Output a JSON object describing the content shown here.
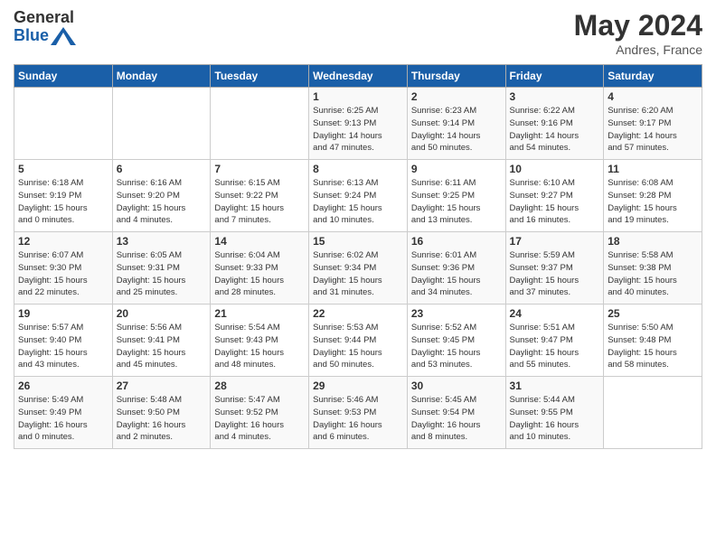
{
  "header": {
    "logo_general": "General",
    "logo_blue": "Blue",
    "month_year": "May 2024",
    "location": "Andres, France"
  },
  "days_of_week": [
    "Sunday",
    "Monday",
    "Tuesday",
    "Wednesday",
    "Thursday",
    "Friday",
    "Saturday"
  ],
  "weeks": [
    [
      {
        "day": "",
        "detail": ""
      },
      {
        "day": "",
        "detail": ""
      },
      {
        "day": "",
        "detail": ""
      },
      {
        "day": "1",
        "detail": "Sunrise: 6:25 AM\nSunset: 9:13 PM\nDaylight: 14 hours\nand 47 minutes."
      },
      {
        "day": "2",
        "detail": "Sunrise: 6:23 AM\nSunset: 9:14 PM\nDaylight: 14 hours\nand 50 minutes."
      },
      {
        "day": "3",
        "detail": "Sunrise: 6:22 AM\nSunset: 9:16 PM\nDaylight: 14 hours\nand 54 minutes."
      },
      {
        "day": "4",
        "detail": "Sunrise: 6:20 AM\nSunset: 9:17 PM\nDaylight: 14 hours\nand 57 minutes."
      }
    ],
    [
      {
        "day": "5",
        "detail": "Sunrise: 6:18 AM\nSunset: 9:19 PM\nDaylight: 15 hours\nand 0 minutes."
      },
      {
        "day": "6",
        "detail": "Sunrise: 6:16 AM\nSunset: 9:20 PM\nDaylight: 15 hours\nand 4 minutes."
      },
      {
        "day": "7",
        "detail": "Sunrise: 6:15 AM\nSunset: 9:22 PM\nDaylight: 15 hours\nand 7 minutes."
      },
      {
        "day": "8",
        "detail": "Sunrise: 6:13 AM\nSunset: 9:24 PM\nDaylight: 15 hours\nand 10 minutes."
      },
      {
        "day": "9",
        "detail": "Sunrise: 6:11 AM\nSunset: 9:25 PM\nDaylight: 15 hours\nand 13 minutes."
      },
      {
        "day": "10",
        "detail": "Sunrise: 6:10 AM\nSunset: 9:27 PM\nDaylight: 15 hours\nand 16 minutes."
      },
      {
        "day": "11",
        "detail": "Sunrise: 6:08 AM\nSunset: 9:28 PM\nDaylight: 15 hours\nand 19 minutes."
      }
    ],
    [
      {
        "day": "12",
        "detail": "Sunrise: 6:07 AM\nSunset: 9:30 PM\nDaylight: 15 hours\nand 22 minutes."
      },
      {
        "day": "13",
        "detail": "Sunrise: 6:05 AM\nSunset: 9:31 PM\nDaylight: 15 hours\nand 25 minutes."
      },
      {
        "day": "14",
        "detail": "Sunrise: 6:04 AM\nSunset: 9:33 PM\nDaylight: 15 hours\nand 28 minutes."
      },
      {
        "day": "15",
        "detail": "Sunrise: 6:02 AM\nSunset: 9:34 PM\nDaylight: 15 hours\nand 31 minutes."
      },
      {
        "day": "16",
        "detail": "Sunrise: 6:01 AM\nSunset: 9:36 PM\nDaylight: 15 hours\nand 34 minutes."
      },
      {
        "day": "17",
        "detail": "Sunrise: 5:59 AM\nSunset: 9:37 PM\nDaylight: 15 hours\nand 37 minutes."
      },
      {
        "day": "18",
        "detail": "Sunrise: 5:58 AM\nSunset: 9:38 PM\nDaylight: 15 hours\nand 40 minutes."
      }
    ],
    [
      {
        "day": "19",
        "detail": "Sunrise: 5:57 AM\nSunset: 9:40 PM\nDaylight: 15 hours\nand 43 minutes."
      },
      {
        "day": "20",
        "detail": "Sunrise: 5:56 AM\nSunset: 9:41 PM\nDaylight: 15 hours\nand 45 minutes."
      },
      {
        "day": "21",
        "detail": "Sunrise: 5:54 AM\nSunset: 9:43 PM\nDaylight: 15 hours\nand 48 minutes."
      },
      {
        "day": "22",
        "detail": "Sunrise: 5:53 AM\nSunset: 9:44 PM\nDaylight: 15 hours\nand 50 minutes."
      },
      {
        "day": "23",
        "detail": "Sunrise: 5:52 AM\nSunset: 9:45 PM\nDaylight: 15 hours\nand 53 minutes."
      },
      {
        "day": "24",
        "detail": "Sunrise: 5:51 AM\nSunset: 9:47 PM\nDaylight: 15 hours\nand 55 minutes."
      },
      {
        "day": "25",
        "detail": "Sunrise: 5:50 AM\nSunset: 9:48 PM\nDaylight: 15 hours\nand 58 minutes."
      }
    ],
    [
      {
        "day": "26",
        "detail": "Sunrise: 5:49 AM\nSunset: 9:49 PM\nDaylight: 16 hours\nand 0 minutes."
      },
      {
        "day": "27",
        "detail": "Sunrise: 5:48 AM\nSunset: 9:50 PM\nDaylight: 16 hours\nand 2 minutes."
      },
      {
        "day": "28",
        "detail": "Sunrise: 5:47 AM\nSunset: 9:52 PM\nDaylight: 16 hours\nand 4 minutes."
      },
      {
        "day": "29",
        "detail": "Sunrise: 5:46 AM\nSunset: 9:53 PM\nDaylight: 16 hours\nand 6 minutes."
      },
      {
        "day": "30",
        "detail": "Sunrise: 5:45 AM\nSunset: 9:54 PM\nDaylight: 16 hours\nand 8 minutes."
      },
      {
        "day": "31",
        "detail": "Sunrise: 5:44 AM\nSunset: 9:55 PM\nDaylight: 16 hours\nand 10 minutes."
      },
      {
        "day": "",
        "detail": ""
      }
    ]
  ]
}
